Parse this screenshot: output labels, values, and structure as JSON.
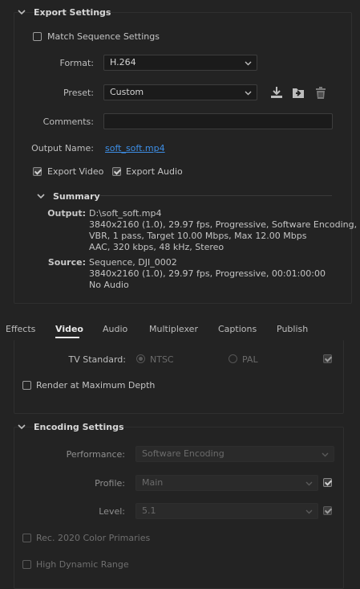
{
  "export_settings": {
    "header": "Export Settings",
    "match_sequence_label": "Match Sequence Settings",
    "format_label": "Format:",
    "format_value": "H.264",
    "preset_label": "Preset:",
    "preset_value": "Custom",
    "comments_label": "Comments:",
    "comments_value": "",
    "output_name_label": "Output Name:",
    "output_name_value": "soft_soft.mp4",
    "export_video_label": "Export Video",
    "export_audio_label": "Export Audio",
    "summary": {
      "header": "Summary",
      "output_label": "Output:",
      "output_lines": [
        "D:\\soft_soft.mp4",
        "3840x2160 (1.0), 29.97 fps, Progressive, Software Encoding, ...",
        "VBR, 1 pass, Target 10.00 Mbps, Max 12.00 Mbps",
        "AAC, 320 kbps, 48 kHz, Stereo"
      ],
      "source_label": "Source:",
      "source_lines": [
        "Sequence, DJI_0002",
        "3840x2160 (1.0), 29.97 fps, Progressive, 00:01:00:00",
        "No Audio"
      ]
    },
    "states": {
      "match_sequence": false,
      "export_video": true,
      "export_audio": true
    }
  },
  "tabs": [
    {
      "label": "Effects",
      "active": false
    },
    {
      "label": "Video",
      "active": true
    },
    {
      "label": "Audio",
      "active": false
    },
    {
      "label": "Multiplexer",
      "active": false
    },
    {
      "label": "Captions",
      "active": false
    },
    {
      "label": "Publish",
      "active": false
    }
  ],
  "video": {
    "tv_standard_label": "TV Standard:",
    "ntsc_label": "NTSC",
    "pal_label": "PAL",
    "render_max_depth_label": "Render at Maximum Depth",
    "states": {
      "ntsc_selected": true,
      "pal_selected": false,
      "tv_standard_match": true,
      "render_max_depth": false
    }
  },
  "encoding": {
    "header": "Encoding Settings",
    "performance_label": "Performance:",
    "performance_value": "Software Encoding",
    "profile_label": "Profile:",
    "profile_value": "Main",
    "level_label": "Level:",
    "level_value": "5.1",
    "rec2020_label": "Rec. 2020 Color Primaries",
    "hdr_label": "High Dynamic Range",
    "states": {
      "profile_match": true,
      "level_match": true,
      "rec2020": false,
      "hdr": false
    }
  },
  "icons": {
    "chevron": "chevron-down-icon",
    "save_preset": "save-preset-icon",
    "import_preset": "import-preset-icon",
    "delete_preset": "trash-icon"
  },
  "colors": {
    "background": "#232323",
    "link": "#3d8ee5",
    "accent_text": "#e6e6e6"
  }
}
